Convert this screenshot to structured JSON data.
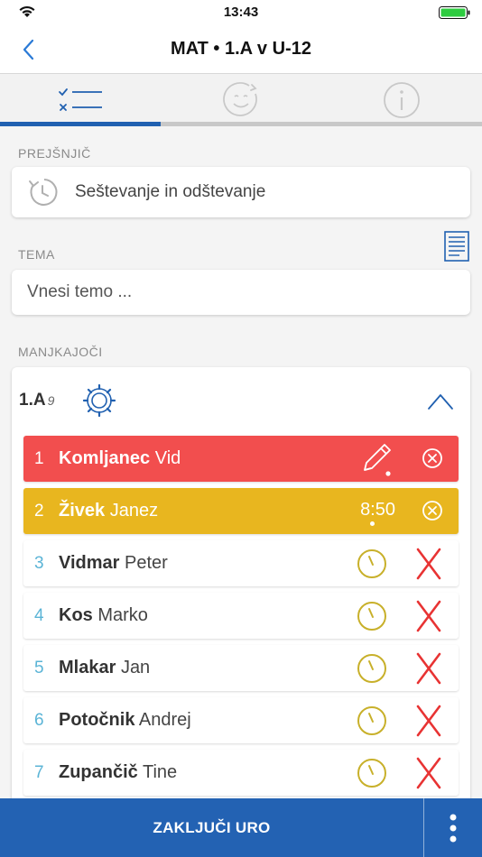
{
  "status_bar": {
    "time": "13:43"
  },
  "header": {
    "title": "MAT • 1.A v U-12"
  },
  "tabs": [
    {
      "name": "attendance",
      "icon": "checklist-icon",
      "active": true
    },
    {
      "name": "evaluation",
      "icon": "smiley-icon",
      "active": false
    },
    {
      "name": "info",
      "icon": "info-icon",
      "active": false
    }
  ],
  "previous": {
    "label": "PREJŠNJIČ",
    "text": "Seštevanje in odštevanje"
  },
  "topic": {
    "label": "TEMA",
    "placeholder": "Vnesi temo ..."
  },
  "absent": {
    "label": "MANJKAJOČI",
    "class_name": "1.A",
    "class_count": "9",
    "students": [
      {
        "num": "1",
        "surname": "Komljanec",
        "first": "Vid",
        "status": "absent"
      },
      {
        "num": "2",
        "surname": "Živek",
        "first": "Janez",
        "status": "late",
        "time": "8:50"
      },
      {
        "num": "3",
        "surname": "Vidmar",
        "first": "Peter",
        "status": "present"
      },
      {
        "num": "4",
        "surname": "Kos",
        "first": "Marko",
        "status": "present"
      },
      {
        "num": "5",
        "surname": "Mlakar",
        "first": "Jan",
        "status": "present"
      },
      {
        "num": "6",
        "surname": "Potočnik",
        "first": " Andrej",
        "status": "present"
      },
      {
        "num": "7",
        "surname": "Zupančič",
        "first": " Tine",
        "status": "present"
      }
    ]
  },
  "footer": {
    "finish_label": "ZAKLJUČI URO"
  },
  "colors": {
    "accent": "#2362b3",
    "absent": "#f24e4e",
    "late": "#e8b61f",
    "clock": "#c8b02a",
    "x": "#e83333",
    "number": "#5bb4d6"
  }
}
